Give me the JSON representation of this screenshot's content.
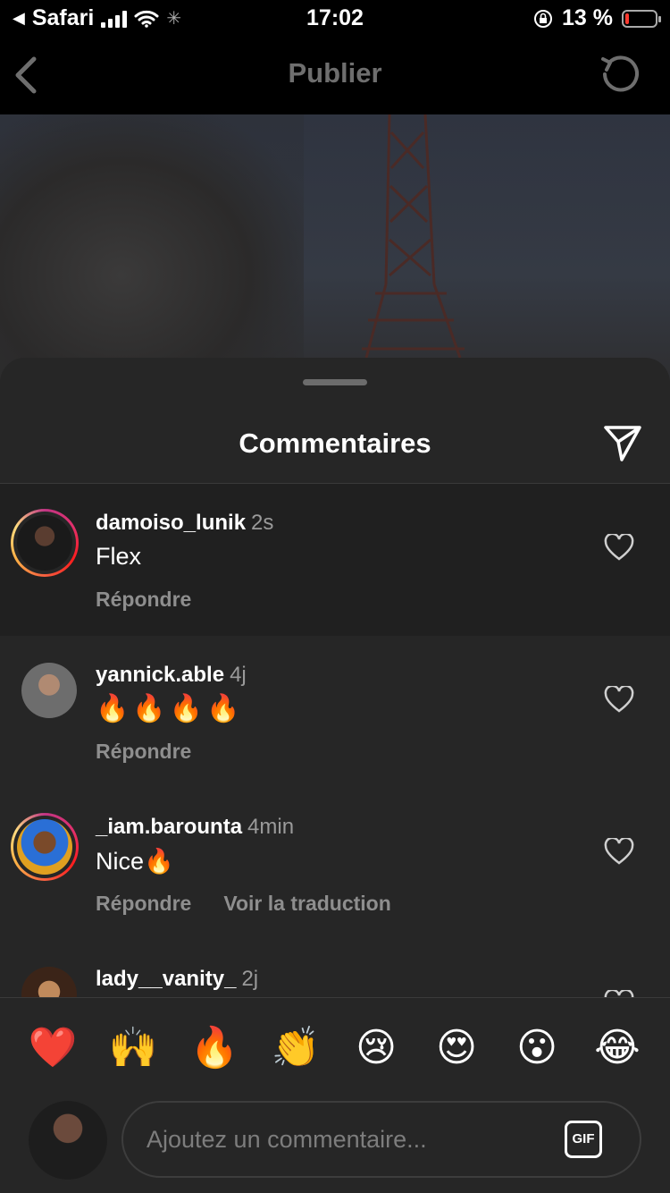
{
  "status_bar": {
    "back_app": "Safari",
    "time": "17:02",
    "battery_text": "13 %",
    "battery_level": 0.13
  },
  "header": {
    "title": "Publier"
  },
  "sheet": {
    "title": "Commentaires"
  },
  "comments": [
    {
      "username": "damoiso_lunik",
      "time": "2s",
      "text": "Flex",
      "actions": [
        "Répondre"
      ],
      "story_ring": true,
      "highlighted": true
    },
    {
      "username": "yannick.able",
      "time": "4j",
      "text": "🔥🔥🔥🔥",
      "actions": [
        "Répondre"
      ],
      "story_ring": false,
      "highlighted": false
    },
    {
      "username": "_iam.barounta",
      "time": "4min",
      "text": "Nice🔥",
      "actions": [
        "Répondre",
        "Voir la traduction"
      ],
      "story_ring": true,
      "highlighted": false
    },
    {
      "username": "lady__vanity_",
      "time": "2j",
      "text": "",
      "actions": [],
      "story_ring": false,
      "highlighted": false
    }
  ],
  "emoji_bar": [
    "❤️",
    "🙌",
    "🔥",
    "👏",
    "😢",
    "😍",
    "😮",
    "😂"
  ],
  "comment_input": {
    "placeholder": "Ajoutez un commentaire...",
    "gif_label": "GIF"
  },
  "icons": [
    "back-chevron-icon",
    "refresh-icon",
    "send-icon",
    "heart-icon",
    "wifi-icon",
    "signal-icon",
    "rotation-lock-icon",
    "battery-icon"
  ],
  "colors": {
    "background": "#000000",
    "sheet": "#262626",
    "highlight_row": "#202020",
    "muted_text": "#8e8e8e",
    "battery_low": "#ff3b30"
  }
}
